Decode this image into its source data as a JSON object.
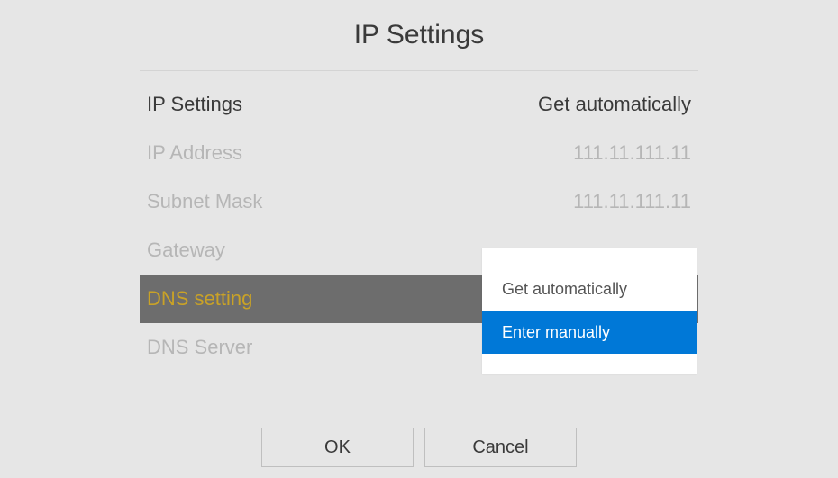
{
  "title": "IP Settings",
  "rows": [
    {
      "label": "IP Settings",
      "value": "Get automatically",
      "state": "normal",
      "interactable": true
    },
    {
      "label": "IP Address",
      "value": "111.11.111.11",
      "state": "disabled",
      "interactable": false
    },
    {
      "label": "Subnet Mask",
      "value": "111.11.111.11",
      "state": "disabled",
      "interactable": false
    },
    {
      "label": "Gateway",
      "value": "",
      "state": "disabled",
      "interactable": false
    },
    {
      "label": "DNS setting",
      "value": "",
      "state": "selected",
      "interactable": true
    },
    {
      "label": "DNS Server",
      "value": "",
      "state": "disabled",
      "interactable": false
    }
  ],
  "buttons": {
    "ok": "OK",
    "cancel": "Cancel"
  },
  "dropdown": {
    "options": [
      {
        "label": "Get automatically",
        "highlighted": false
      },
      {
        "label": "Enter manually",
        "highlighted": true
      }
    ]
  }
}
